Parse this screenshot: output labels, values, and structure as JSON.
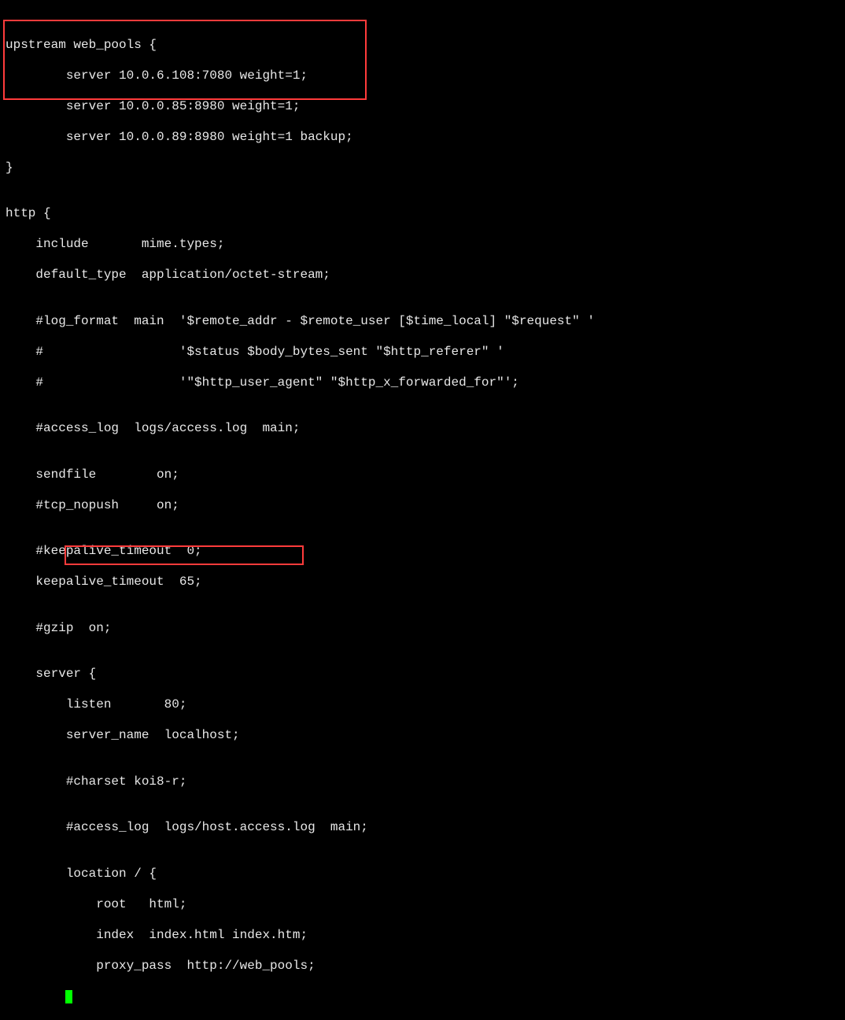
{
  "lines": {
    "l01": "upstream web_pools {",
    "l02": "        server 10.0.6.108:7080 weight=1;",
    "l03": "        server 10.0.0.85:8980 weight=1;",
    "l04": "        server 10.0.0.89:8980 weight=1 backup;",
    "l05": "}",
    "l06": "",
    "l07": "http {",
    "l08": "    include       mime.types;",
    "l09": "    default_type  application/octet-stream;",
    "l10": "",
    "l11": "    #log_format  main  '$remote_addr - $remote_user [$time_local] \"$request\" '",
    "l12": "    #                  '$status $body_bytes_sent \"$http_referer\" '",
    "l13": "    #                  '\"$http_user_agent\" \"$http_x_forwarded_for\"';",
    "l14": "",
    "l15": "    #access_log  logs/access.log  main;",
    "l16": "",
    "l17": "    sendfile        on;",
    "l18": "    #tcp_nopush     on;",
    "l19": "",
    "l20": "    #keepalive_timeout  0;",
    "l21": "    keepalive_timeout  65;",
    "l22": "",
    "l23": "    #gzip  on;",
    "l24": "",
    "l25": "    server {",
    "l26": "        listen       80;",
    "l27": "        server_name  localhost;",
    "l28": "",
    "l29": "        #charset koi8-r;",
    "l30": "",
    "l31": "        #access_log  logs/host.access.log  main;",
    "l32": "",
    "l33": "        location / {",
    "l34": "            root   html;",
    "l35": "            index  index.html index.htm;",
    "l36": "            proxy_pass  http://web_pools;",
    "l37": "        }"
  }
}
